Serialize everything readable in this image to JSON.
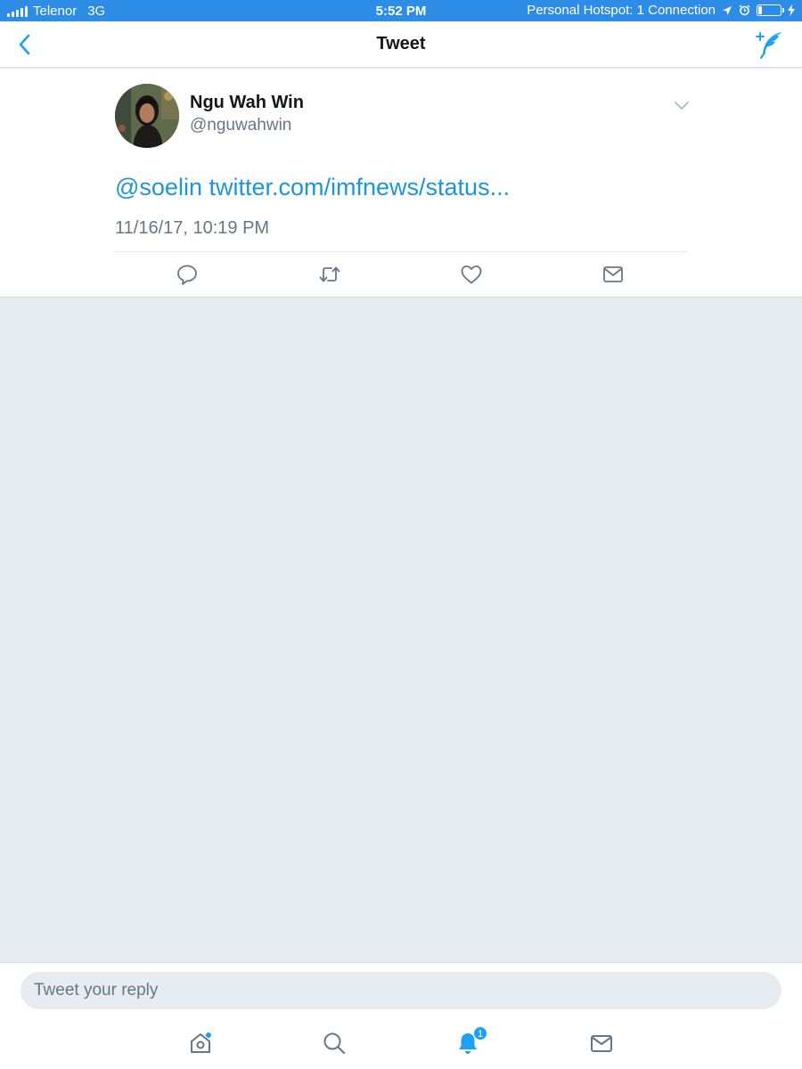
{
  "status_bar": {
    "carrier": "Telenor",
    "network": "3G",
    "time": "5:52 PM",
    "hotspot": "Personal Hotspot: 1 Connection",
    "battery_level": 0.15
  },
  "nav": {
    "title": "Tweet",
    "back_icon": "chevron-left-icon",
    "compose_icon": "compose-tweet-icon"
  },
  "tweet": {
    "author_name": "Ngu Wah Win",
    "author_handle": "@nguwahwin",
    "mention": "@soelin",
    "link": "twitter.com/imfnews/status...",
    "timestamp": "11/16/17, 10:19 PM",
    "actions": [
      "reply-icon",
      "retweet-icon",
      "like-icon",
      "direct-message-icon"
    ]
  },
  "reply": {
    "placeholder": "Tweet your reply"
  },
  "tab_bar": {
    "tabs": [
      "home-icon",
      "search-icon",
      "notifications-icon",
      "messages-icon"
    ],
    "notification_count": "1"
  },
  "colors": {
    "accent": "#1da1f2",
    "link": "#1b95e0",
    "status_bar": "#2c8ce6",
    "background": "#e6ecf0",
    "secondary_text": "#657786"
  }
}
